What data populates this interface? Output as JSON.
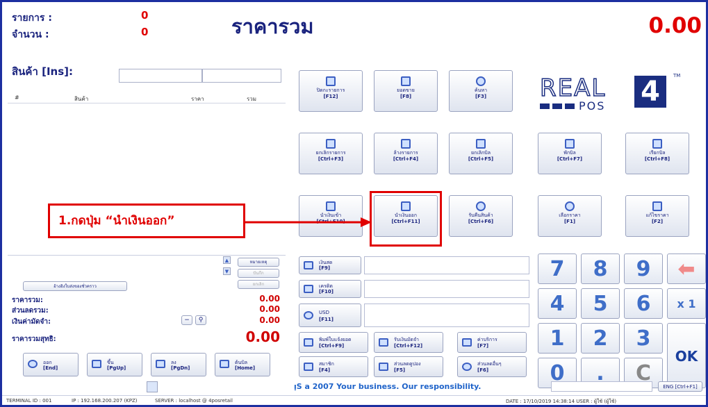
{
  "header": {
    "items_label": "รายการ :",
    "items_value": "0",
    "qty_label": "จำนวน :",
    "qty_value": "0",
    "title": "ราคารวม",
    "total": "0.00"
  },
  "entry": {
    "label": "สินค้า [Ins]:",
    "columns": [
      "#",
      "สินค้า",
      "ราคา",
      "รวม"
    ]
  },
  "logo": {
    "text": "REAL",
    "sub": "POS",
    "digit": "4",
    "tm": "TM"
  },
  "function_buttons": [
    {
      "line1": "ปิดกะรายการ",
      "line2": "[F12]"
    },
    {
      "line1": "ยอดขาย",
      "line2": "[F8]"
    },
    {
      "line1": "ค้นหา",
      "line2": "[F3]"
    },
    {
      "line1": "ยกเลิกรายการ",
      "line2": "[Ctrl+F3]"
    },
    {
      "line1": "ล้างรายการ",
      "line2": "[Ctrl+F4]"
    },
    {
      "line1": "ยกเลิกบิล",
      "line2": "[Ctrl+F5]"
    },
    {
      "line1": "พักบิล",
      "line2": "[Ctrl+F7]"
    },
    {
      "line1": "เรียกบิล",
      "line2": "[Ctrl+F8]"
    },
    {
      "line1": "นำเงินเข้า",
      "line2": "[Ctrl+F10]"
    },
    {
      "line1": "นำเงินออก",
      "line2": "[Ctrl+F11]"
    },
    {
      "line1": "รับคืนสินค้า",
      "line2": "[Ctrl+F6]"
    },
    {
      "line1": "เลือกราคา",
      "line2": "[F1]"
    },
    {
      "line1": "แก้ไขราคา",
      "line2": "[F2]"
    }
  ],
  "annotation": {
    "text": "1.กดปุ่ม “นำเงินออก”",
    "highlight_color": "#e00000"
  },
  "payment_buttons": [
    {
      "line1": "เงินสด",
      "line2": "[F9]"
    },
    {
      "line1": "เครดิต",
      "line2": "[F10]"
    },
    {
      "line1": "USD",
      "line2": "[F11]"
    }
  ],
  "bottom_buttons": [
    {
      "line1": "พิมพ์ใบแจ้งยอด",
      "line2": "[Ctrl+F9]"
    },
    {
      "line1": "รับเงินมัดจำ",
      "line2": "[Ctrl+F12]"
    },
    {
      "line1": "ค่าบริการ",
      "line2": "[F7]"
    },
    {
      "line1": "สมาชิก",
      "line2": "[F4]"
    },
    {
      "line1": "ส่วนลดคูปอง",
      "line2": "[F5]"
    },
    {
      "line1": "ส่วนลดอื่นๆ",
      "line2": "[F6]"
    }
  ],
  "keypad": {
    "row1": [
      "7",
      "8",
      "9"
    ],
    "row2": [
      "4",
      "5",
      "6"
    ],
    "row3": [
      "1",
      "2",
      "3"
    ],
    "row4": [
      "0",
      "."
    ],
    "multiply": "x 1",
    "ok": "OK",
    "clear": "C"
  },
  "left_panel": {
    "note_btn": "หมายเหตุ",
    "sub1": "ปันกึก",
    "sub2": "ยกเลิก",
    "weight_btn": "อ้างอิงใบส่งของชั่วคราว",
    "subtotal_label": "ราคารวม:",
    "subtotal": "0.00",
    "discount_label": "ส่วนลดรวม:",
    "discount": "0.00",
    "deposit_label": "เงินค่ามัดจำ:",
    "deposit": "0.00",
    "net_label": "ราคารวมสุทธิ:",
    "net": "0.00",
    "nav": [
      {
        "line1": "ออก",
        "line2": "[End]"
      },
      {
        "line1": "ขึ้น",
        "line2": "[PgUp]"
      },
      {
        "line1": "ลง",
        "line2": "[PgDn]"
      },
      {
        "line1": "ต้นบิล",
        "line2": "[Home]"
      }
    ]
  },
  "ticker": "ᴉS a 2007 Your business. Our responsibility.",
  "lang_btn": "ENG [Ctrl+F1]",
  "status": {
    "terminal": "TERMINAL ID : 001",
    "ip": "IP : 192.168.200.207 (KPZ)",
    "server": "SERVER : localhost @ 4posretail",
    "date": "DATE : 17/10/2019  14:38:14   USER : ผู้ใช้ (ผู้ใช้)"
  }
}
